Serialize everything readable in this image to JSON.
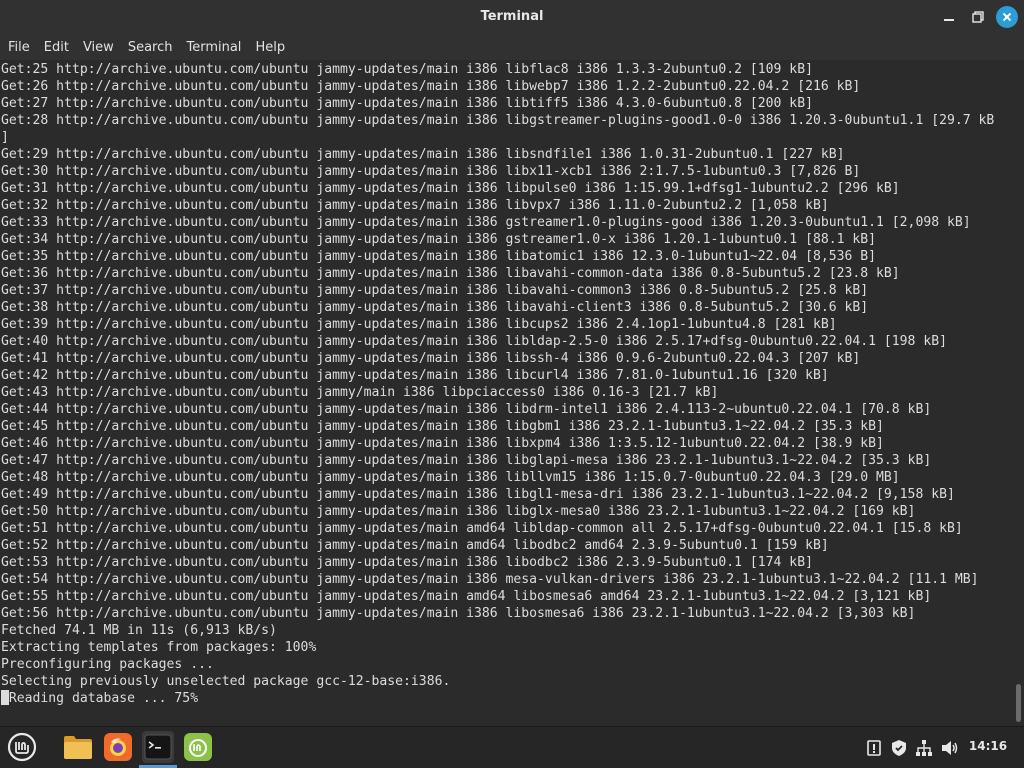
{
  "window": {
    "title": "Terminal",
    "minimize_icon": "minimize-icon",
    "maximize_icon": "maximize-icon",
    "close_icon": "close-icon",
    "close_color": "#2b9cd6"
  },
  "menu": [
    "File",
    "Edit",
    "View",
    "Search",
    "Terminal",
    "Help"
  ],
  "terminal": {
    "lines": [
      "Get:25 http://archive.ubuntu.com/ubuntu jammy-updates/main i386 libflac8 i386 1.3.3-2ubuntu0.2 [109 kB]",
      "Get:26 http://archive.ubuntu.com/ubuntu jammy-updates/main i386 libwebp7 i386 1.2.2-2ubuntu0.22.04.2 [216 kB]",
      "Get:27 http://archive.ubuntu.com/ubuntu jammy-updates/main i386 libtiff5 i386 4.3.0-6ubuntu0.8 [200 kB]",
      "Get:28 http://archive.ubuntu.com/ubuntu jammy-updates/main i386 libgstreamer-plugins-good1.0-0 i386 1.20.3-0ubuntu1.1 [29.7 kB",
      "]",
      "Get:29 http://archive.ubuntu.com/ubuntu jammy-updates/main i386 libsndfile1 i386 1.0.31-2ubuntu0.1 [227 kB]",
      "Get:30 http://archive.ubuntu.com/ubuntu jammy-updates/main i386 libx11-xcb1 i386 2:1.7.5-1ubuntu0.3 [7,826 B]",
      "Get:31 http://archive.ubuntu.com/ubuntu jammy-updates/main i386 libpulse0 i386 1:15.99.1+dfsg1-1ubuntu2.2 [296 kB]",
      "Get:32 http://archive.ubuntu.com/ubuntu jammy-updates/main i386 libvpx7 i386 1.11.0-2ubuntu2.2 [1,058 kB]",
      "Get:33 http://archive.ubuntu.com/ubuntu jammy-updates/main i386 gstreamer1.0-plugins-good i386 1.20.3-0ubuntu1.1 [2,098 kB]",
      "Get:34 http://archive.ubuntu.com/ubuntu jammy-updates/main i386 gstreamer1.0-x i386 1.20.1-1ubuntu0.1 [88.1 kB]",
      "Get:35 http://archive.ubuntu.com/ubuntu jammy-updates/main i386 libatomic1 i386 12.3.0-1ubuntu1~22.04 [8,536 B]",
      "Get:36 http://archive.ubuntu.com/ubuntu jammy-updates/main i386 libavahi-common-data i386 0.8-5ubuntu5.2 [23.8 kB]",
      "Get:37 http://archive.ubuntu.com/ubuntu jammy-updates/main i386 libavahi-common3 i386 0.8-5ubuntu5.2 [25.8 kB]",
      "Get:38 http://archive.ubuntu.com/ubuntu jammy-updates/main i386 libavahi-client3 i386 0.8-5ubuntu5.2 [30.6 kB]",
      "Get:39 http://archive.ubuntu.com/ubuntu jammy-updates/main i386 libcups2 i386 2.4.1op1-1ubuntu4.8 [281 kB]",
      "Get:40 http://archive.ubuntu.com/ubuntu jammy-updates/main i386 libldap-2.5-0 i386 2.5.17+dfsg-0ubuntu0.22.04.1 [198 kB]",
      "Get:41 http://archive.ubuntu.com/ubuntu jammy-updates/main i386 libssh-4 i386 0.9.6-2ubuntu0.22.04.3 [207 kB]",
      "Get:42 http://archive.ubuntu.com/ubuntu jammy-updates/main i386 libcurl4 i386 7.81.0-1ubuntu1.16 [320 kB]",
      "Get:43 http://archive.ubuntu.com/ubuntu jammy/main i386 libpciaccess0 i386 0.16-3 [21.7 kB]",
      "Get:44 http://archive.ubuntu.com/ubuntu jammy-updates/main i386 libdrm-intel1 i386 2.4.113-2~ubuntu0.22.04.1 [70.8 kB]",
      "Get:45 http://archive.ubuntu.com/ubuntu jammy-updates/main i386 libgbm1 i386 23.2.1-1ubuntu3.1~22.04.2 [35.3 kB]",
      "Get:46 http://archive.ubuntu.com/ubuntu jammy-updates/main i386 libxpm4 i386 1:3.5.12-1ubuntu0.22.04.2 [38.9 kB]",
      "Get:47 http://archive.ubuntu.com/ubuntu jammy-updates/main i386 libglapi-mesa i386 23.2.1-1ubuntu3.1~22.04.2 [35.3 kB]",
      "Get:48 http://archive.ubuntu.com/ubuntu jammy-updates/main i386 libllvm15 i386 1:15.0.7-0ubuntu0.22.04.3 [29.0 MB]",
      "Get:49 http://archive.ubuntu.com/ubuntu jammy-updates/main i386 libgl1-mesa-dri i386 23.2.1-1ubuntu3.1~22.04.2 [9,158 kB]",
      "Get:50 http://archive.ubuntu.com/ubuntu jammy-updates/main i386 libglx-mesa0 i386 23.2.1-1ubuntu3.1~22.04.2 [169 kB]",
      "Get:51 http://archive.ubuntu.com/ubuntu jammy-updates/main amd64 libldap-common all 2.5.17+dfsg-0ubuntu0.22.04.1 [15.8 kB]",
      "Get:52 http://archive.ubuntu.com/ubuntu jammy-updates/main amd64 libodbc2 amd64 2.3.9-5ubuntu0.1 [159 kB]",
      "Get:53 http://archive.ubuntu.com/ubuntu jammy-updates/main i386 libodbc2 i386 2.3.9-5ubuntu0.1 [174 kB]",
      "Get:54 http://archive.ubuntu.com/ubuntu jammy-updates/main i386 mesa-vulkan-drivers i386 23.2.1-1ubuntu3.1~22.04.2 [11.1 MB]",
      "Get:55 http://archive.ubuntu.com/ubuntu jammy-updates/main amd64 libosmesa6 amd64 23.2.1-1ubuntu3.1~22.04.2 [3,121 kB]",
      "Get:56 http://archive.ubuntu.com/ubuntu jammy-updates/main i386 libosmesa6 i386 23.2.1-1ubuntu3.1~22.04.2 [3,303 kB]",
      "Fetched 74.1 MB in 11s (6,913 kB/s)",
      "Extracting templates from packages: 100%",
      "Preconfiguring packages ...",
      "Selecting previously unselected package gcc-12-base:i386.",
      "(Reading database ... 75%"
    ],
    "text_color": "#dcdcdc",
    "background": "#2b2b2b"
  },
  "taskbar": {
    "apps": [
      {
        "name": "mint-menu-icon",
        "color": "#e8e8e8"
      },
      {
        "name": "files-icon",
        "color": "#e8b54a"
      },
      {
        "name": "firefox-icon",
        "color": "#f26b2a"
      },
      {
        "name": "terminal-icon",
        "color": "#1e1e1e"
      },
      {
        "name": "mintinstall-icon",
        "color": "#8bc34a"
      }
    ],
    "tray": [
      "update-manager-icon",
      "shield-icon",
      "network-icon",
      "volume-icon"
    ],
    "clock": "14:16",
    "indicator_color": "#5b9bd5"
  }
}
